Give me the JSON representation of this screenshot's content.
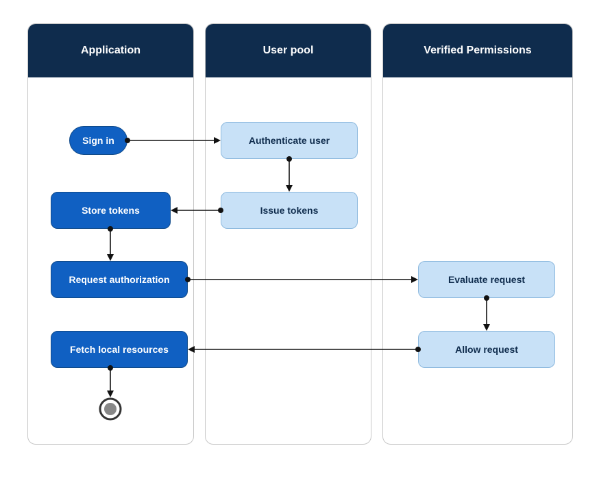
{
  "lanes": {
    "application": {
      "title": "Application"
    },
    "userpool": {
      "title": "User pool"
    },
    "verified": {
      "title": "Verified Permissions"
    }
  },
  "nodes": {
    "sign_in": "Sign in",
    "authenticate_user": "Authenticate user",
    "issue_tokens": "Issue tokens",
    "store_tokens": "Store tokens",
    "request_authorization": "Request authorization",
    "evaluate_request": "Evaluate request",
    "allow_request": "Allow request",
    "fetch_local_resources": "Fetch local resources"
  }
}
